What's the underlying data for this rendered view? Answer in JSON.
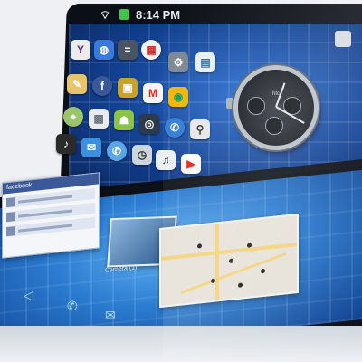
{
  "status_bar": {
    "wifi_icon": "wifi-icon",
    "battery_icon": "battery-icon",
    "battery_color": "#43c24a",
    "time": "8:14 PM"
  },
  "home_screen": {
    "app_icons": [
      {
        "name": "yahoo-icon",
        "glyph": "Y",
        "color": "#ececec",
        "fg": "#5a2d91"
      },
      {
        "name": "globe-icon",
        "glyph": "◍",
        "color": "#3a7ad9",
        "fg": "#ffffff"
      },
      {
        "name": "calculator-icon",
        "glyph": "=",
        "color": "#4a5563",
        "fg": "#ffffff"
      },
      {
        "name": "calendar-icon",
        "glyph": "▦",
        "color": "#f2f2f2",
        "fg": "#c0392b"
      },
      {
        "name": "settings-icon",
        "glyph": "⚙",
        "color": "#7c8794",
        "fg": "#ffffff"
      },
      {
        "name": "grid-app-icon",
        "glyph": "▤",
        "color": "#e8eef5",
        "fg": "#2b6cb0"
      },
      {
        "name": "notes-icon",
        "glyph": "✎",
        "color": "#e9c46a",
        "fg": "#ffffff"
      },
      {
        "name": "facebook-icon",
        "glyph": "f",
        "color": "#3b5998",
        "fg": "#ffffff"
      },
      {
        "name": "photo-icon",
        "glyph": "▣",
        "color": "#c9a227",
        "fg": "#ffffff"
      },
      {
        "name": "gmail-icon",
        "glyph": "M",
        "color": "#f5f5f5",
        "fg": "#d93025"
      },
      {
        "name": "chrome-icon",
        "glyph": "◉",
        "color": "#f4b400",
        "fg": "#0f9d58"
      },
      {
        "name": "maps-icon",
        "glyph": "⌖",
        "color": "#9cc46b",
        "fg": "#ffffff"
      },
      {
        "name": "gallery-icon",
        "glyph": "▩",
        "color": "#e9ecef",
        "fg": "#6c757d"
      },
      {
        "name": "android-icon",
        "glyph": "☗",
        "color": "#8bc34a",
        "fg": "#ffffff"
      },
      {
        "name": "camera-icon",
        "glyph": "◎",
        "color": "#2d3a4a",
        "fg": "#ffffff"
      },
      {
        "name": "phone-icon",
        "glyph": "✆",
        "color": "#2e7bd6",
        "fg": "#ffffff"
      },
      {
        "name": "search-icon",
        "glyph": "⚲",
        "color": "#e6e6e6",
        "fg": "#333333"
      },
      {
        "name": "music-icon",
        "glyph": "♪",
        "color": "#2b2b2b",
        "fg": "#ffffff"
      },
      {
        "name": "talk-icon",
        "glyph": "✉",
        "color": "#3d8fe0",
        "fg": "#ffffff"
      },
      {
        "name": "voice-icon",
        "glyph": "✆",
        "color": "#5aa7e8",
        "fg": "#ffffff"
      },
      {
        "name": "clock-app-icon",
        "glyph": "◷",
        "color": "#cfd5dc",
        "fg": "#333333"
      },
      {
        "name": "microphone-icon",
        "glyph": "♫",
        "color": "#eceff2",
        "fg": "#333333"
      },
      {
        "name": "youtube-icon",
        "glyph": "▶",
        "color": "#ffffff",
        "fg": "#e62117"
      }
    ]
  },
  "clock_widget": {
    "brand": "htc"
  },
  "facebook_window": {
    "title": "facebook"
  },
  "camera_window": {
    "label": "Camera (1)"
  },
  "dock": {
    "icons": [
      "back-icon",
      "phone-icon",
      "mail-icon"
    ]
  }
}
